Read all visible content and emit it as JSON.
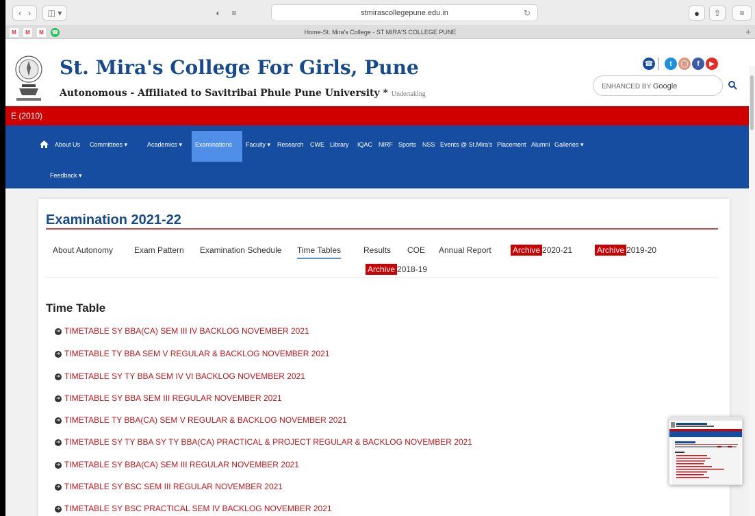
{
  "browser": {
    "url": "stmirascollegepune.edu.in",
    "tab_title": "Home-St. Mira's College - ST MIRA'S COLLEGE PUNE",
    "favicons": [
      "gmail-icon",
      "gmail-icon",
      "gmail-icon",
      "whatsapp-icon"
    ],
    "new_tab_label": "+"
  },
  "site": {
    "title": "St. Mira's College For Girls, Pune",
    "subtitle": "Autonomous - Affiliated to Savitribai Phule Pune University",
    "asterisk": "*",
    "undertaking": "Undertaking",
    "search_brand": "ENHANCED BY",
    "search_google": "Google"
  },
  "ticker": {
    "text": "E (2010)"
  },
  "nav": {
    "items": [
      {
        "label": "About Us"
      },
      {
        "label": "Committees ▾"
      },
      {
        "label": "Academics ▾"
      },
      {
        "label": "Examinations"
      },
      {
        "label": "Faculty ▾"
      },
      {
        "label": "Research"
      },
      {
        "label": "CWE"
      },
      {
        "label": "Library"
      },
      {
        "label": "IQAC"
      },
      {
        "label": "NIRF"
      },
      {
        "label": "Sports"
      },
      {
        "label": "NSS"
      },
      {
        "label": "Events @ St.Mira's"
      },
      {
        "label": "Placement"
      },
      {
        "label": "Alumni"
      },
      {
        "label": "Galleries ▾"
      },
      {
        "label": "Feedback ▾"
      }
    ]
  },
  "exam": {
    "title": "Examination 2021-22",
    "tabs": [
      {
        "label": "About Autonomy"
      },
      {
        "label": "Exam Pattern"
      },
      {
        "label": "Examination Schedule"
      },
      {
        "label": "Time Tables"
      },
      {
        "label": "Results"
      },
      {
        "label": "COE"
      },
      {
        "label": "Annual Report"
      }
    ],
    "archive_tag": "Archive",
    "archives": [
      {
        "year": "2020-21"
      },
      {
        "year": "2019-20"
      },
      {
        "year": "2018-19"
      }
    ],
    "section_heading": "Time Table",
    "timetables": [
      {
        "label": "TIMETABLE SY BBA(CA) SEM III IV BACKLOG NOVEMBER 2021"
      },
      {
        "label": "TIMETABLE TY BBA SEM V REGULAR & BACKLOG NOVEMBER 2021"
      },
      {
        "label": "TIMETABLE SY TY BBA SEM IV VI BACKLOG NOVEMBER 2021"
      },
      {
        "label": "TIMETABLE SY BBA SEM III REGULAR NOVEMBER 2021"
      },
      {
        "label": "TIMETABLE TY BBA(CA) SEM V REGULAR & BACKLOG NOVEMBER 2021"
      },
      {
        "label": "TIMETABLE SY TY BBA SY TY BBA(CA) PRACTICAL & PROJECT REGULAR & BACKLOG NOVEMBER 2021"
      },
      {
        "label": "TIMETABLE SY BBA(CA) SEM III REGULAR NOVEMBER 2021"
      },
      {
        "label": "TIMETABLE SY BSC SEM III REGULAR NOVEMBER 2021"
      },
      {
        "label": "TIMETABLE SY BSC PRACTICAL SEM IV BACKLOG NOVEMBER 2021"
      }
    ]
  },
  "colors": {
    "brand_blue": "#174a8c",
    "nav_blue": "#164da0",
    "active_nav": "#4f8fe8",
    "ticker_red": "#d00000",
    "link_red": "#c0161b"
  }
}
